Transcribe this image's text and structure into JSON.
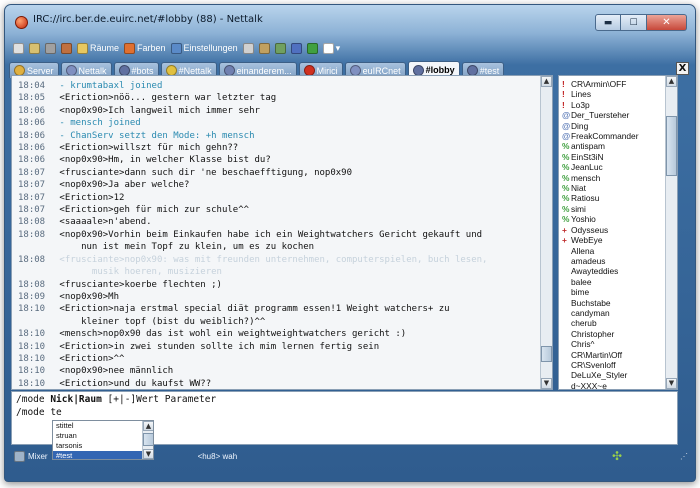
{
  "window": {
    "title": "IRC://irc.ber.de.euirc.net/#lobby (88)  -  Nettalk",
    "minimize": "▬",
    "maximize": "☐",
    "close": "✕"
  },
  "toolbar": {
    "items": [
      {
        "label": "",
        "icon": "connect-icon",
        "color": "#e0e0e0"
      },
      {
        "label": "",
        "icon": "folder-icon",
        "color": "#d8c070"
      },
      {
        "label": "",
        "icon": "disconnect-icon",
        "color": "#a0a0a0"
      },
      {
        "label": "",
        "icon": "tools-icon",
        "color": "#c07040"
      },
      {
        "label": "Räume",
        "icon": "rooms-icon",
        "color": "#e8c860"
      },
      {
        "label": "Farben",
        "icon": "colors-icon",
        "color": "#e07030"
      },
      {
        "label": "Einstellungen",
        "icon": "settings-icon",
        "color": "#5a8ac8"
      },
      {
        "label": "",
        "icon": "script-icon",
        "color": "#d0d0d0"
      },
      {
        "label": "",
        "icon": "log-icon",
        "color": "#c0a060"
      },
      {
        "label": "",
        "icon": "dcc-icon",
        "color": "#70a060"
      },
      {
        "label": "",
        "icon": "help-icon",
        "color": "#5070c0"
      },
      {
        "label": "",
        "icon": "plugin-icon",
        "color": "#40a040"
      },
      {
        "label": "▾",
        "icon": "dropdown-icon",
        "color": "#ffffff"
      }
    ]
  },
  "tabs": [
    {
      "label": "Server",
      "icon": "server-tab-icon",
      "color": "#e0b040",
      "active": false
    },
    {
      "label": "Nettalk",
      "icon": "network-tab-icon",
      "color": "#8090c0",
      "active": false
    },
    {
      "label": "#bots",
      "icon": "channel-tab-icon",
      "color": "#6070a0",
      "active": false
    },
    {
      "label": "#Nettalk",
      "icon": "channel-tab-icon",
      "color": "#e0c040",
      "active": false
    },
    {
      "label": "einanderem...",
      "icon": "channel-tab-icon",
      "color": "#7080b0",
      "active": false
    },
    {
      "label": "Mirici",
      "icon": "query-tab-icon",
      "color": "#d03020",
      "active": false
    },
    {
      "label": "euIRCnet",
      "icon": "network-tab-icon",
      "color": "#8090c0",
      "active": false
    },
    {
      "label": "#lobby",
      "icon": "channel-tab-icon",
      "color": "#6070a0",
      "active": true
    },
    {
      "label": "#test",
      "icon": "channel-tab-icon",
      "color": "#6070a0",
      "active": false
    }
  ],
  "tab_close": "X",
  "chat": {
    "lines": [
      {
        "time": "18:04",
        "text": " - krumtabaxl joined",
        "kind": "sys"
      },
      {
        "time": "18:05",
        "text": " <Eriction>nöö... gestern war letzter tag",
        "kind": "msg"
      },
      {
        "time": "18:06",
        "text": " <nop0x90>Ich langweil mich immer sehr",
        "kind": "msg"
      },
      {
        "time": "18:06",
        "text": " - mensch joined",
        "kind": "sys"
      },
      {
        "time": "18:06",
        "text": " - ChanServ setzt den Mode: +h mensch",
        "kind": "sys"
      },
      {
        "time": "18:06",
        "text": " <Eriction>willszt für mich gehn??",
        "kind": "msg"
      },
      {
        "time": "18:06",
        "text": " <nop0x90>Hm, in welcher Klasse bist du?",
        "kind": "msg"
      },
      {
        "time": "18:07",
        "text": " <frusciante>dann such dir 'ne beschaefftigung, nop0x90",
        "kind": "msg"
      },
      {
        "time": "18:07",
        "text": " <nop0x90>Ja aber welche?",
        "kind": "msg"
      },
      {
        "time": "18:07",
        "text": " <Eriction>12",
        "kind": "msg"
      },
      {
        "time": "18:07",
        "text": " <Eriction>geh für mich zur schule^^",
        "kind": "msg"
      },
      {
        "time": "18:08",
        "text": " <saaaale>n'abend.",
        "kind": "msg"
      },
      {
        "time": "18:08",
        "text": " <nop0x90>Vorhin beim Einkaufen habe ich ein Weightwatchers Gericht gekauft und",
        "kind": "msg"
      },
      {
        "time": "",
        "text": "     nun ist mein Topf zu klein, um es zu kochen",
        "kind": "msg"
      },
      {
        "time": "18:08",
        "text": " <frusciante>nop0x90: was mit freunden unternehmen, computerspielen, buch lesen,",
        "kind": "faded"
      },
      {
        "time": "",
        "text": "       musik hoeren, musizieren",
        "kind": "faded"
      },
      {
        "time": "18:08",
        "text": " <frusciante>koerbe flechten ;)",
        "kind": "msg"
      },
      {
        "time": "18:09",
        "text": " <nop0x90>Mh",
        "kind": "msg"
      },
      {
        "time": "18:10",
        "text": " <Eriction>naja erstmal special diät programm essen!1 Weight watchers+ zu",
        "kind": "msg"
      },
      {
        "time": "",
        "text": "     kleiner topf (bist du weiblich?)^^",
        "kind": "msg"
      },
      {
        "time": "18:10",
        "text": " <mensch>nop0x90 das ist wohl ein weightweightwatchers gericht :)",
        "kind": "msg"
      },
      {
        "time": "18:10",
        "text": " <Eriction>in zwei stunden sollte ich mim lernen fertig sein",
        "kind": "msg"
      },
      {
        "time": "18:10",
        "text": " <Eriction>^^",
        "kind": "msg"
      },
      {
        "time": "18:10",
        "text": " <nop0x90>nee männlich",
        "kind": "msg"
      },
      {
        "time": "18:10",
        "text": " <Eriction>und du kaufst WW??",
        "kind": "msg"
      },
      {
        "time": "18:10",
        "text": " <nop0x90>ja, selber kann ich nicht so gut kochen",
        "kind": "msg"
      }
    ]
  },
  "users": [
    {
      "name": "CR\\Armin\\OFF",
      "prefix": "!",
      "color": "#c02020"
    },
    {
      "name": "Lines",
      "prefix": "!",
      "color": "#c02020"
    },
    {
      "name": "Lo3p",
      "prefix": "!",
      "color": "#c02020"
    },
    {
      "name": "Der_Tuersteher",
      "prefix": "@",
      "color": "#5a7ab8"
    },
    {
      "name": "Ding",
      "prefix": "@",
      "color": "#5a7ab8"
    },
    {
      "name": "FreakCommander",
      "prefix": "@",
      "color": "#5a7ab8"
    },
    {
      "name": "antispam",
      "prefix": "%",
      "color": "#40a040"
    },
    {
      "name": "EinSt3iN",
      "prefix": "%",
      "color": "#40a040"
    },
    {
      "name": "JeanLuc",
      "prefix": "%",
      "color": "#40a040"
    },
    {
      "name": "mensch",
      "prefix": "%",
      "color": "#40a040"
    },
    {
      "name": "Niat",
      "prefix": "%",
      "color": "#40a040"
    },
    {
      "name": "Ratiosu",
      "prefix": "%",
      "color": "#40a040"
    },
    {
      "name": "simi",
      "prefix": "%",
      "color": "#40a040"
    },
    {
      "name": "Yoshio",
      "prefix": "%",
      "color": "#40a040"
    },
    {
      "name": "Odysseus",
      "prefix": "+",
      "color": "#c03030"
    },
    {
      "name": "WebEye",
      "prefix": "+",
      "color": "#c03030"
    },
    {
      "name": "Allena",
      "prefix": "",
      "color": "#ffffff"
    },
    {
      "name": "amadeus",
      "prefix": "",
      "color": "#ffffff"
    },
    {
      "name": "Awayteddies",
      "prefix": "",
      "color": "#ffffff"
    },
    {
      "name": "balee",
      "prefix": "",
      "color": "#ffffff"
    },
    {
      "name": "bime",
      "prefix": "",
      "color": "#ffffff"
    },
    {
      "name": "Buchstabe",
      "prefix": "",
      "color": "#ffffff"
    },
    {
      "name": "candyman",
      "prefix": "",
      "color": "#ffffff"
    },
    {
      "name": "cherub",
      "prefix": "",
      "color": "#ffffff"
    },
    {
      "name": "Christopher",
      "prefix": "",
      "color": "#ffffff"
    },
    {
      "name": "Chris^",
      "prefix": "",
      "color": "#ffffff"
    },
    {
      "name": "CR\\Martin\\Off",
      "prefix": "",
      "color": "#ffffff"
    },
    {
      "name": "CR\\Svenloff",
      "prefix": "",
      "color": "#ffffff"
    },
    {
      "name": "DeLuXe_Styler",
      "prefix": "",
      "color": "#ffffff"
    },
    {
      "name": "d~XXX~e",
      "prefix": "",
      "color": "#ffffff"
    }
  ],
  "input": {
    "hint_cmd": "/mode ",
    "hint_nick": "Nick|Raum",
    "hint_rest": " [+|-]Wert Parameter",
    "value": "/mode te"
  },
  "autocomplete": {
    "items": [
      "stittel",
      "struan",
      "tarsonis",
      "#test"
    ],
    "selected": 3
  },
  "status": {
    "mixer": "Mixer",
    "nick_info": "<hu8> wah"
  }
}
